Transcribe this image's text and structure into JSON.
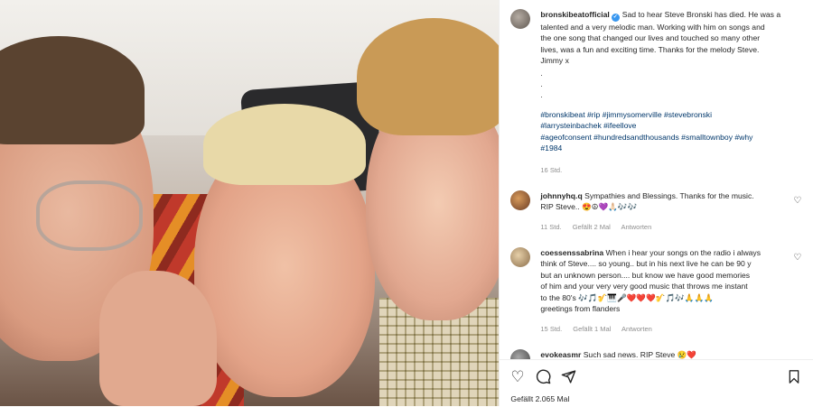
{
  "post": {
    "author": "bronskibeatofficial",
    "verified": true,
    "caption_lines": [
      "Sad to hear Steve Bronski has died. He was a",
      "talented and a very melodic man. Working with him on songs and",
      "the one song that changed our lives and touched so many other",
      "lives, was a fun and exciting time. Thanks for the melody Steve.",
      "Jimmy x"
    ],
    "dots": [
      ".",
      ".",
      "."
    ],
    "hashtag_lines": [
      "#bronskibeat #rip #jimmysomerville #stevebronski",
      "#larrysteinbachek #ifeellove",
      "#ageofconsent #hundredsandthousands #smalltownboy #why",
      "#1984"
    ],
    "time": "16 Std."
  },
  "comments": [
    {
      "user": "johnnyhq.q",
      "lines": [
        "Sympathies and Blessings. Thanks for the music.",
        "RIP Steve.. 😍☮💜🙏🏻🎶🎶"
      ],
      "time": "11 Std.",
      "likes": "Gefällt 2 Mal",
      "reply": "Antworten",
      "heart_icon": "heart-outline-icon"
    },
    {
      "user": "coessenssabrina",
      "lines": [
        "When i hear your songs on the radio i always",
        "think of Steve.... so young.. but in his next live he can be 90 y",
        "but an unknown person.... but know we have good memories",
        "of him and your very very good music that throws me instant",
        "to the 80's 🎶🎵🎷🎹🎤❤️❤️❤️🎷🎵🎶🙏🙏🙏",
        "greetings from flanders"
      ],
      "time": "15 Std.",
      "likes": "Gefällt 1 Mal",
      "reply": "Antworten",
      "heart_icon": "heart-outline-icon"
    },
    {
      "user": "evokeasmr",
      "lines": [
        "Such sad news. RIP Steve 😢❤️"
      ],
      "heart_icon": "heart-outline-icon"
    }
  ],
  "actions": {
    "like_icon": "heart-outline-icon",
    "comment_icon": "comment-bubble-icon",
    "share_icon": "paper-plane-icon",
    "save_icon": "bookmark-icon",
    "likes_text": "Gefällt 2.065 Mal"
  },
  "colors": {
    "hashtag": "#00376b",
    "verified": "#3897f0",
    "muted": "#8e8e8e"
  }
}
